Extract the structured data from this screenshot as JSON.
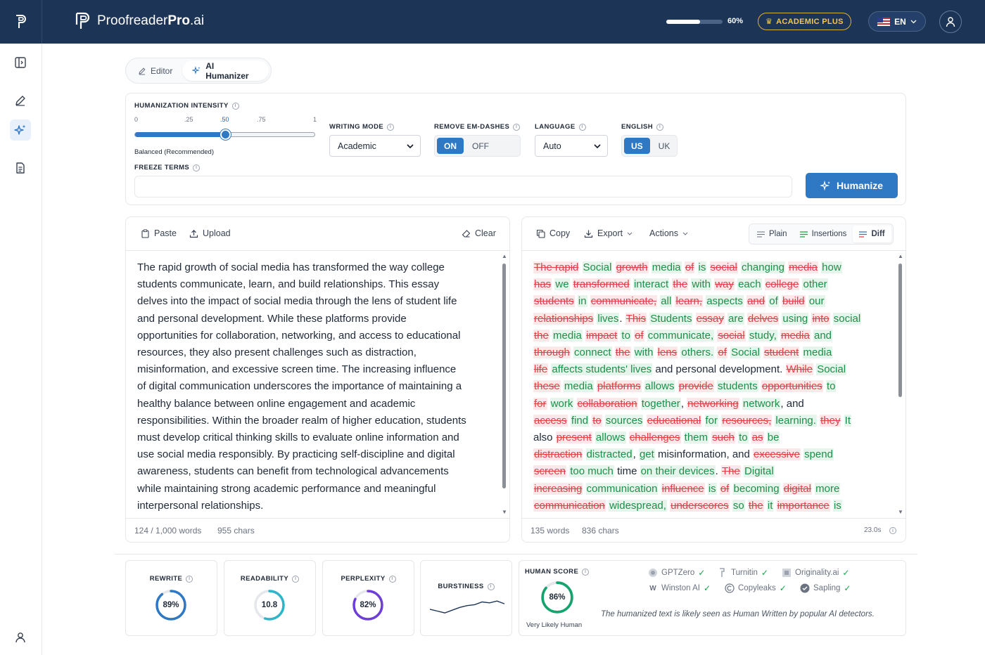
{
  "app": {
    "brand_light": "Proofreader",
    "brand_bold": "Pro",
    "brand_suffix": ".ai",
    "usage_percent": 60,
    "usage_label": "60%",
    "plan_label": "ACADEMIC PLUS",
    "language_label": "EN"
  },
  "mode_tabs": [
    {
      "label": "Editor",
      "icon": "pencil-icon"
    },
    {
      "label": "AI Humanizer",
      "icon": "sparkles-icon"
    }
  ],
  "settings": {
    "intensity_label": "HUMANIZATION INTENSITY",
    "intensity_ticks": [
      "0",
      ".25",
      ".50",
      ".75",
      "1"
    ],
    "intensity_value": 0.5,
    "intensity_caption": "Balanced (Recommended)",
    "writing_mode_label": "WRITING MODE",
    "writing_mode_value": "Academic",
    "em_dash_label": "REMOVE EM-DASHES",
    "em_dash_on": "ON",
    "em_dash_off": "OFF",
    "language_label": "LANGUAGE",
    "language_value": "Auto",
    "english_label": "ENGLISH",
    "english_us": "US",
    "english_uk": "UK",
    "freeze_label": "FREEZE TERMS",
    "freeze_value": "",
    "humanize_label": "Humanize"
  },
  "input_panel": {
    "paste_label": "Paste",
    "upload_label": "Upload",
    "clear_label": "Clear",
    "lines": [
      "The rapid growth of social media has transformed the way college",
      "students communicate, learn, and build relationships. This essay",
      "delves into the impact of social media through the lens of student life",
      "and personal development. While these platforms provide",
      "opportunities for collaboration, networking, and access to educational",
      "resources, they also present challenges such as distraction,",
      "misinformation, and excessive screen time. The increasing influence",
      "of digital communication underscores the importance of maintaining a",
      "healthy balance between online engagement and academic",
      "responsibilities. Within the broader realm of higher education, students",
      "must develop critical thinking skills to evaluate online information and",
      "use social media responsibly. By practicing self-discipline and digital",
      "awareness, students can benefit from technological advancements",
      "while maintaining strong academic performance and meaningful",
      "interpersonal relationships."
    ],
    "word_count": "124 / 1,000 words",
    "char_count": "955 chars"
  },
  "output_panel": {
    "copy_label": "Copy",
    "export_label": "Export",
    "actions_label": "Actions",
    "view_tabs": [
      {
        "label": "Plain",
        "icon": "lines-icon"
      },
      {
        "label": "Insertions",
        "icon": "lines-icon"
      },
      {
        "label": "Diff",
        "icon": "lines-icon"
      }
    ],
    "active_view": "Diff",
    "diff_lines": [
      [
        [
          "del",
          "The rapid"
        ],
        [
          "ins",
          "Social"
        ],
        [
          "del",
          "growth"
        ],
        [
          "ins",
          "media"
        ],
        [
          "del",
          "of"
        ],
        [
          "ins",
          "is"
        ],
        [
          "del",
          "social"
        ],
        [
          "ins",
          "changing"
        ],
        [
          "del",
          "media"
        ],
        [
          "ins",
          "how"
        ]
      ],
      [
        [
          "del",
          "has"
        ],
        [
          "ins",
          "we"
        ],
        [
          "del",
          "transformed"
        ],
        [
          "ins",
          "interact"
        ],
        [
          "del",
          "the"
        ],
        [
          "ins",
          "with"
        ],
        [
          "del",
          "way"
        ],
        [
          "ins",
          "each"
        ],
        [
          "del",
          "college"
        ],
        [
          "ins",
          "other"
        ]
      ],
      [
        [
          "del",
          "students"
        ],
        [
          "ins",
          "in"
        ],
        [
          "del",
          "communicate,"
        ],
        [
          "ins",
          "all"
        ],
        [
          "del",
          "learn,"
        ],
        [
          "ins",
          "aspects"
        ],
        [
          "del",
          "and"
        ],
        [
          "ins",
          "of"
        ],
        [
          "del",
          "build"
        ],
        [
          "ins",
          "our"
        ]
      ],
      [
        [
          "del",
          "relationships"
        ],
        [
          "ins",
          "lives"
        ],
        [
          "eq",
          "."
        ],
        [
          "del",
          "This"
        ],
        [
          "ins",
          "Students"
        ],
        [
          "del",
          "essay"
        ],
        [
          "ins",
          "are"
        ],
        [
          "del",
          "delves"
        ],
        [
          "ins",
          "using"
        ],
        [
          "del",
          "into"
        ],
        [
          "ins",
          "social"
        ]
      ],
      [
        [
          "del",
          "the"
        ],
        [
          "ins",
          "media"
        ],
        [
          "del",
          "impact"
        ],
        [
          "ins",
          "to"
        ],
        [
          "del",
          "of"
        ],
        [
          "ins",
          "communicate,"
        ],
        [
          "del",
          "social"
        ],
        [
          "ins",
          "study,"
        ],
        [
          "del",
          "media"
        ],
        [
          "ins",
          "and"
        ]
      ],
      [
        [
          "del",
          "through"
        ],
        [
          "ins",
          "connect"
        ],
        [
          "del",
          "the"
        ],
        [
          "ins",
          "with"
        ],
        [
          "del",
          "lens"
        ],
        [
          "ins",
          "others."
        ],
        [
          "del",
          "of"
        ],
        [
          "ins",
          "Social"
        ],
        [
          "del",
          "student"
        ],
        [
          "ins",
          "media"
        ]
      ],
      [
        [
          "del",
          "life"
        ],
        [
          "ins",
          "affects students' lives"
        ],
        [
          "eq",
          "and personal development."
        ],
        [
          "del",
          "While"
        ],
        [
          "ins",
          "Social"
        ]
      ],
      [
        [
          "del",
          "these"
        ],
        [
          "ins",
          "media"
        ],
        [
          "del",
          "platforms"
        ],
        [
          "ins",
          "allows"
        ],
        [
          "del",
          "provide"
        ],
        [
          "ins",
          "students"
        ],
        [
          "del",
          "opportunities"
        ],
        [
          "ins",
          "to"
        ]
      ],
      [
        [
          "del",
          "for"
        ],
        [
          "ins",
          "work"
        ],
        [
          "del",
          "collaboration"
        ],
        [
          "ins",
          "together"
        ],
        [
          "eq",
          ","
        ],
        [
          "del",
          "networking"
        ],
        [
          "ins",
          "network"
        ],
        [
          "eq",
          ", and"
        ]
      ],
      [
        [
          "del",
          "access"
        ],
        [
          "ins",
          "find"
        ],
        [
          "del",
          "to"
        ],
        [
          "ins",
          "sources"
        ],
        [
          "del",
          "educational"
        ],
        [
          "ins",
          "for"
        ],
        [
          "del",
          "resources,"
        ],
        [
          "ins",
          "learning."
        ],
        [
          "del",
          "they"
        ],
        [
          "ins",
          "It"
        ]
      ],
      [
        [
          "eq",
          "also"
        ],
        [
          "del",
          "present"
        ],
        [
          "ins",
          "allows"
        ],
        [
          "del",
          "challenges"
        ],
        [
          "ins",
          "them"
        ],
        [
          "del",
          "such"
        ],
        [
          "ins",
          "to"
        ],
        [
          "del",
          "as"
        ],
        [
          "ins",
          "be"
        ]
      ],
      [
        [
          "del",
          "distraction"
        ],
        [
          "ins",
          "distracted"
        ],
        [
          "eq",
          ","
        ],
        [
          "ins",
          "get"
        ],
        [
          "eq",
          "misinformation, and"
        ],
        [
          "del",
          "excessive"
        ],
        [
          "ins",
          "spend"
        ]
      ],
      [
        [
          "del",
          "screen"
        ],
        [
          "ins",
          "too much"
        ],
        [
          "eq",
          "time"
        ],
        [
          "ins",
          "on their devices"
        ],
        [
          "eq",
          "."
        ],
        [
          "del",
          "The"
        ],
        [
          "ins",
          "Digital"
        ]
      ],
      [
        [
          "del",
          "increasing"
        ],
        [
          "ins",
          "communication"
        ],
        [
          "del",
          "influence"
        ],
        [
          "ins",
          "is"
        ],
        [
          "del",
          "of"
        ],
        [
          "ins",
          "becoming"
        ],
        [
          "del",
          "digital"
        ],
        [
          "ins",
          "more"
        ]
      ],
      [
        [
          "del",
          "communication"
        ],
        [
          "ins",
          "widespread,"
        ],
        [
          "del",
          "underscores"
        ],
        [
          "ins",
          "so"
        ],
        [
          "del",
          "the"
        ],
        [
          "ins",
          "it"
        ],
        [
          "del",
          "importance"
        ],
        [
          "ins",
          "is"
        ]
      ]
    ],
    "word_count": "135 words",
    "char_count": "836 chars",
    "elapsed": "23.0s"
  },
  "metrics": [
    {
      "label": "REWRITE",
      "value": "89%",
      "fraction": 0.89,
      "color": "#2f78c4"
    },
    {
      "label": "READABILITY",
      "value": "10.8",
      "fraction": 0.55,
      "color": "#2eb5c9"
    },
    {
      "label": "PERPLEXITY",
      "value": "82%",
      "fraction": 0.82,
      "color": "#6e3fd8"
    }
  ],
  "burstiness": {
    "label": "BURSTINESS",
    "points": [
      0.35,
      0.25,
      0.15,
      0.3,
      0.45,
      0.55,
      0.6,
      0.75,
      0.7,
      0.8,
      0.65
    ]
  },
  "human_score": {
    "label": "HUMAN SCORE",
    "value": "86%",
    "fraction": 0.86,
    "color": "#16a36e",
    "caption": "Very Likely Human",
    "detectors": [
      {
        "name": "GPTZero",
        "icon": "gptzero-icon"
      },
      {
        "name": "Turnitin",
        "icon": "turnitin-icon"
      },
      {
        "name": "Originality.ai",
        "icon": "originality-icon"
      },
      {
        "name": "Winston AI",
        "icon": "winston-icon"
      },
      {
        "name": "Copyleaks",
        "icon": "copyleaks-icon"
      },
      {
        "name": "Sapling",
        "icon": "sapling-icon"
      }
    ],
    "note": "The humanized text is likely seen as Human Written by popular AI detectors."
  },
  "colors": {
    "navy": "#1c3557",
    "accent": "#2f78c4",
    "gold": "#f5c84a",
    "deleted": "#e0404a",
    "inserted": "#1c8f49"
  }
}
